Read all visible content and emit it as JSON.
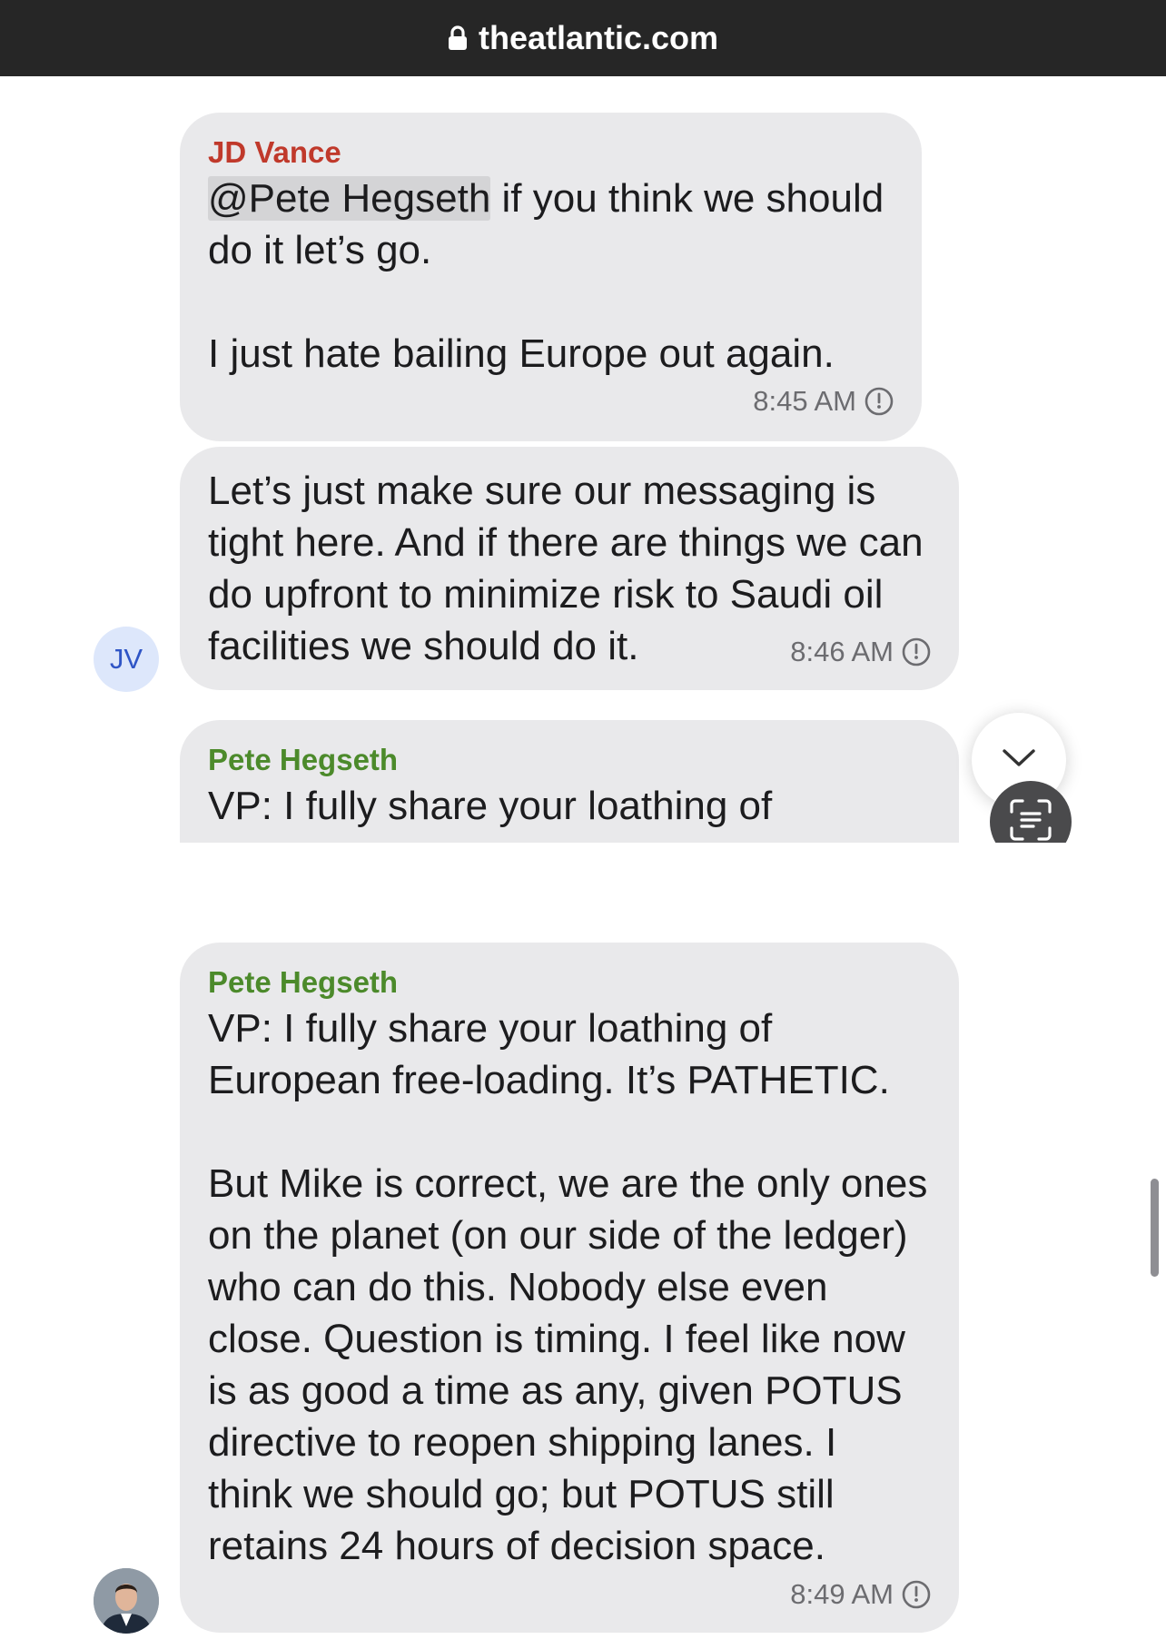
{
  "browser": {
    "url": "theatlantic.com"
  },
  "colors": {
    "vance": "#c0392b",
    "hegseth": "#4c8a2b",
    "bubble": "#e9e9eb"
  },
  "messages": [
    {
      "sender": "JD Vance",
      "mention": "@Pete Hegseth",
      "text": " if you think we should do it let’s go.\n\nI just hate bailing Europe out again.",
      "time": "8:45 AM",
      "status_icon": "clock-icon"
    },
    {
      "text": "Let’s just make sure our messaging is tight here. And if there are things we can do upfront to minimize risk to Saudi oil facilities we should do it.",
      "time": "8:46 AM",
      "status_icon": "clock-icon",
      "avatar_initials": "JV"
    },
    {
      "sender": "Pete Hegseth",
      "text": "VP: I fully share your loathing of"
    },
    {
      "sender": "Pete Hegseth",
      "text": "VP: I fully share your loathing of European free-loading. It’s PATHETIC.\n\nBut Mike is correct, we are the only ones on the planet (on our side of the ledger) who can do this. Nobody else even close. Question is timing. I feel like now is as good a time as any, given POTUS directive to reopen shipping lanes. I think we should go; but POTUS still retains 24 hours of decision space.",
      "time": "8:49 AM",
      "status_icon": "clock-icon"
    }
  ]
}
